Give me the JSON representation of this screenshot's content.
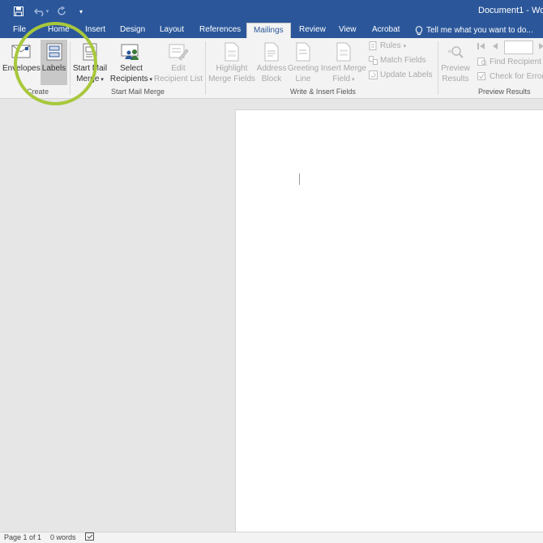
{
  "window": {
    "title": "Document1 - Wor"
  },
  "tabs": [
    {
      "label": "File"
    },
    {
      "label": "Home"
    },
    {
      "label": "Insert"
    },
    {
      "label": "Design"
    },
    {
      "label": "Layout"
    },
    {
      "label": "References"
    },
    {
      "label": "Mailings"
    },
    {
      "label": "Review"
    },
    {
      "label": "View"
    },
    {
      "label": "Acrobat"
    }
  ],
  "tell_me": {
    "text": "Tell me what you want to do..."
  },
  "ribbon": {
    "create": {
      "label": "Create",
      "envelopes": "Envelopes",
      "labels": "Labels"
    },
    "start_mail_merge": {
      "label": "Start Mail Merge",
      "start_line1": "Start Mail",
      "start_line2": "Merge",
      "select_line1": "Select",
      "select_line2": "Recipients",
      "edit_line1": "Edit",
      "edit_line2": "Recipient List"
    },
    "write_insert": {
      "label": "Write & Insert Fields",
      "highlight_line1": "Highlight",
      "highlight_line2": "Merge Fields",
      "address_line1": "Address",
      "address_line2": "Block",
      "greeting_line1": "Greeting",
      "greeting_line2": "Line",
      "insert_line1": "Insert Merge",
      "insert_line2": "Field",
      "rules": "Rules",
      "match": "Match Fields",
      "update": "Update Labels"
    },
    "preview": {
      "label": "Preview Results",
      "preview_line1": "Preview",
      "preview_line2": "Results",
      "find": "Find Recipient",
      "check": "Check for Errors"
    }
  },
  "status": {
    "page": "Page 1 of 1",
    "words": "0 words"
  },
  "colors": {
    "brand": "#2b579a",
    "highlight": "#a8c83c"
  }
}
